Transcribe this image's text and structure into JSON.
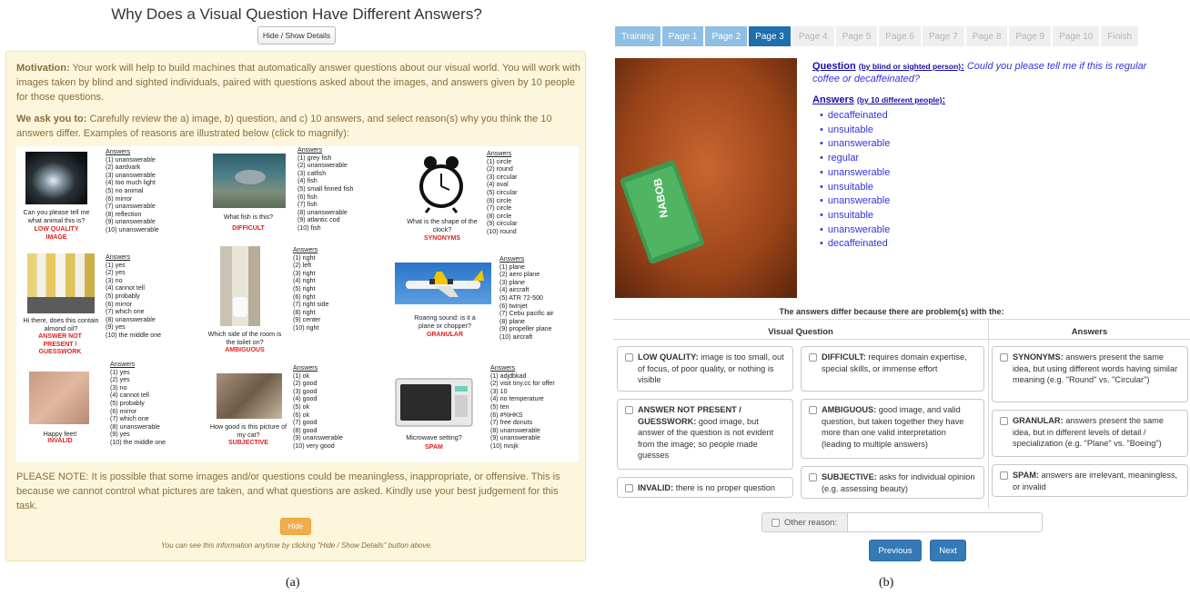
{
  "panel_a": {
    "title": "Why Does a Visual Question Have Different Answers?",
    "toggle_button": "Hide / Show Details",
    "motivation_label": "Motivation:",
    "motivation_text": " Your work will help to build machines that automatically answer questions about our visual world. You will work with images taken by blind and sighted individuals, paired with questions asked about the images, and answers given by 10 people for those questions.",
    "ask_label": "We ask you to:",
    "ask_text": " Carefully review the a) image, b) question, and c) 10 answers, and select reason(s) why you think the 10 answers differ. Examples of reasons are illustrated below (click to magnify):",
    "answers_header": "Answers",
    "examples": [
      {
        "question": "Can you please tell me what animal this is?",
        "reason": "LOW QUALITY IMAGE",
        "answers": [
          "(1) unanswerable",
          "(2) aardvark",
          "(3) unanswerable",
          "(4) too much light",
          "(5) no animal",
          "(6) mirror",
          "(7) unanswerable",
          "(8) reflection",
          "(9) unanswerable",
          "(10) unanswerable"
        ]
      },
      {
        "question": "What fish is this?",
        "reason": "DIFFICULT",
        "answers": [
          "(1) grey fish",
          "(2) unanswerable",
          "(3) catfish",
          "(4) fish",
          "(5) small finned fish",
          "(6) fish",
          "(7) fish",
          "(8) unanswerable",
          "(9) atlantic cod",
          "(10) fish"
        ]
      },
      {
        "question": "What is the shape of the clock?",
        "reason": "SYNONYMS",
        "answers": [
          "(1) circle",
          "(2) round",
          "(3) circular",
          "(4) oval",
          "(5) circular",
          "(6) circle",
          "(7) circle",
          "(8) circle",
          "(9) circular",
          "(10) round"
        ]
      },
      {
        "question": "Hi there, does this contain almond oil?",
        "reason": "ANSWER NOT PRESENT / GUESSWORK",
        "answers": [
          "(1) yes",
          "(2) yes",
          "(3) no",
          "(4) cannot tell",
          "(5) probably",
          "(6) mirror",
          "(7) which one",
          "(8) unanswerable",
          "(9) yes",
          "(10) the middle one"
        ]
      },
      {
        "question": "Which side of the room is the toilet on?",
        "reason": "AMBIGUOUS",
        "answers": [
          "(1) right",
          "(2) left",
          "(3) right",
          "(4) right",
          "(5) right",
          "(6) right",
          "(7) right side",
          "(8) right",
          "(9) center",
          "(10) right"
        ]
      },
      {
        "question": "Roaring sound: is it a plane or chopper?",
        "reason": "GRANULAR",
        "answers": [
          "(1) plane",
          "(2) aero plane",
          "(3) plane",
          "(4) aircraft",
          "(5) ATR 72-500",
          "(6) twinjet",
          "(7) Cebu pacific air",
          "(8) plane",
          "(9) propeller plane",
          "(10) aircraft"
        ]
      },
      {
        "question": "Happy feet!",
        "reason": "INVALID",
        "answers": [
          "(1) yes",
          "(2) yes",
          "(3) no",
          "(4) cannot tell",
          "(5) probably",
          "(6) mirror",
          "(7) which one",
          "(8) unanswerable",
          "(9) yes",
          "(10) the middle one"
        ]
      },
      {
        "question": "How good is this picture of my cat?",
        "reason": "SUBJECTIVE",
        "answers": [
          "(1) ok",
          "(2) good",
          "(3) good",
          "(4) good",
          "(5) ok",
          "(6) ok",
          "(7) good",
          "(8) good",
          "(9) unanswerable",
          "(10) very good"
        ]
      },
      {
        "question": "Microwave setting?",
        "reason": "SPAM",
        "answers": [
          "(1) adjdbkad",
          "(2) visit tiny.cc for offer",
          "(3) 10",
          "(4) no temperature",
          "(5) ten",
          "(6) #%HKS",
          "(7) free donuts",
          "(8) unanswerable",
          "(9) unanswerable",
          "(10) nvsjk"
        ]
      }
    ],
    "note": "PLEASE NOTE: It is possible that some images and/or questions could be meaningless, inappropriate, or offensive. This is because we cannot control what pictures are taken, and what questions are asked. Kindly use your best judgement for this task.",
    "hide_button": "Hide",
    "footer": "You can see this information anytime by clicking \"Hide / Show Details\" button above.",
    "caption": "(a)"
  },
  "panel_b": {
    "tabs": [
      "Training",
      "Page 1",
      "Page 2",
      "Page 3",
      "Page 4",
      "Page 5",
      "Page 6",
      "Page 7",
      "Page 8",
      "Page 9",
      "Page 10",
      "Finish"
    ],
    "active_tab": 3,
    "package_text": "NABOB",
    "question_label": "Question",
    "question_sub": "(by blind or sighted person)",
    "question_text": "Could you please tell me if this is regular coffee or decaffeinated?",
    "answers_label": "Answers",
    "answers_sub": "(by 10 different people)",
    "answers": [
      "decaffeinated",
      "unsuitable",
      "unanswerable",
      "regular",
      "unanswerable",
      "unsuitable",
      "unanswerable",
      "unsuitable",
      "unanswerable",
      "decaffeinated"
    ],
    "differ_text": "The answers differ because there are problem(s) with the:",
    "col_visual_question": "Visual Question",
    "col_answers": "Answers",
    "reasons": {
      "low_quality": {
        "label": "LOW QUALITY:",
        "desc": " image is too small, out of focus, of poor quality, or nothing is visible"
      },
      "difficult": {
        "label": "DIFFICULT:",
        "desc": " requires domain expertise, special skills, or immense effort"
      },
      "synonyms": {
        "label": "SYNONYMS:",
        "desc": " answers present the same idea, but using different words having similar meaning (e.g. \"Round\" vs. \"Circular\")"
      },
      "answer_not_present": {
        "label": "ANSWER NOT PRESENT / GUESSWORK:",
        "desc": " good image, but answer of the question is not evident from the image; so people made guesses"
      },
      "ambiguous": {
        "label": "AMBIGUOUS:",
        "desc": " good image, and valid question, but taken together they have more than one valid interpretation (leading to multiple answers)"
      },
      "granular": {
        "label": "GRANULAR:",
        "desc": " answers present the same idea, but in different levels of detail / specialization (e.g. \"Plane\" vs. \"Boeing\")"
      },
      "invalid": {
        "label": "INVALID:",
        "desc": " there is no proper question"
      },
      "subjective": {
        "label": "SUBJECTIVE:",
        "desc": " asks for individual opinion (e.g. assessing beauty)"
      },
      "spam": {
        "label": "SPAM:",
        "desc": " answers are irrelevant, meaningless, or invalid"
      }
    },
    "other_label": "Other reason:",
    "other_value": "",
    "previous_button": "Previous",
    "next_button": "Next",
    "caption": "(b)"
  }
}
